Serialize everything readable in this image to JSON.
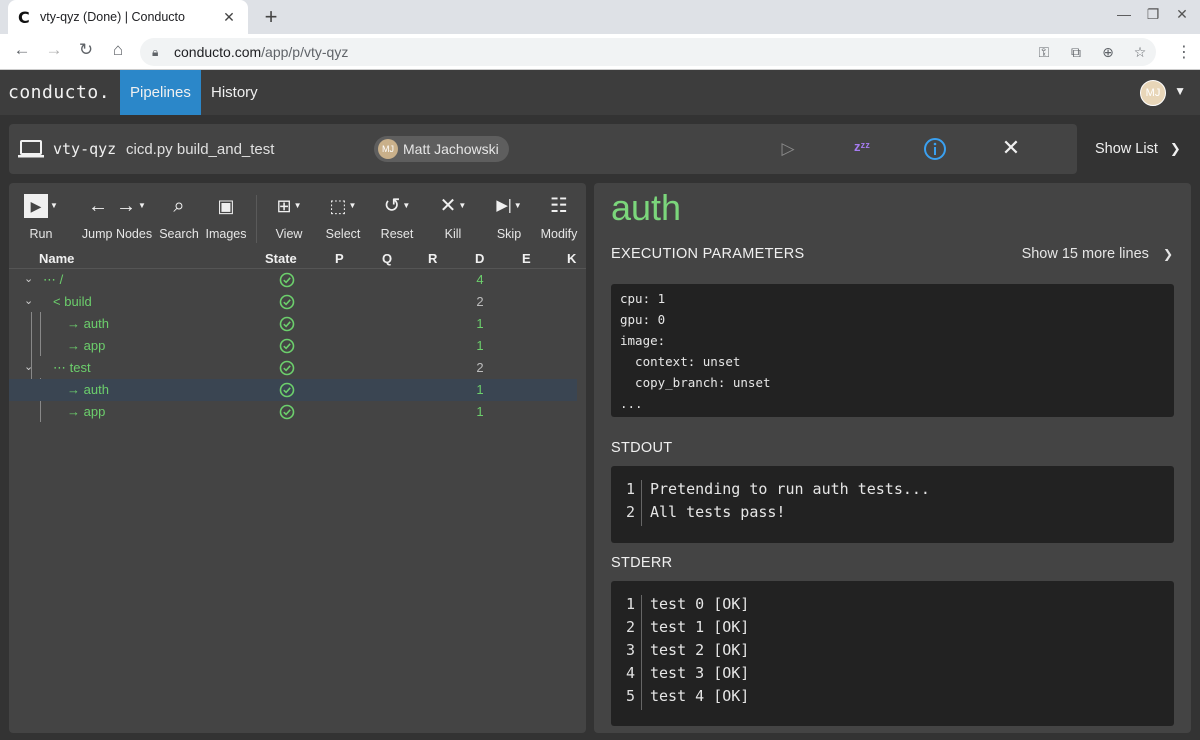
{
  "browser": {
    "tab_favicon": "C",
    "tab_title": "vty-qyz (Done) | Conducto",
    "url_host": "conducto.com",
    "url_path": "/app/p/vty-qyz"
  },
  "app": {
    "logo": "conducto.",
    "nav": [
      "Pipelines",
      "History"
    ],
    "user_initials": "MJ"
  },
  "pipeline": {
    "id": "vty-qyz",
    "command": "cicd.py build_and_test",
    "owner": "Matt Jachowski",
    "owner_initials": "MJ",
    "show_list": "Show List"
  },
  "toolbar": [
    "Run",
    "Jump Nodes",
    "Search",
    "Images",
    "View",
    "Select",
    "Reset",
    "Kill",
    "Skip",
    "Modify"
  ],
  "tree": {
    "columns": [
      "Name",
      "State",
      "P",
      "Q",
      "R",
      "D",
      "E",
      "K"
    ],
    "rows": [
      {
        "name": "/",
        "d": "4"
      },
      {
        "name": "build",
        "d": "2"
      },
      {
        "name": "auth",
        "d": "1"
      },
      {
        "name": "app",
        "d": "1"
      },
      {
        "name": "test",
        "d": "2"
      },
      {
        "name": "auth",
        "d": "1"
      },
      {
        "name": "app",
        "d": "1"
      }
    ]
  },
  "detail": {
    "title": "auth",
    "exec_params_title": "EXECUTION PARAMETERS",
    "show_more": "Show 15 more lines",
    "params": [
      "cpu: 1",
      "gpu: 0",
      "image:",
      "  context: unset",
      "  copy_branch: unset",
      "..."
    ],
    "stdout_title": "STDOUT",
    "stdout": [
      {
        "n": "1",
        "text": "Pretending to run auth tests..."
      },
      {
        "n": "2",
        "text": "All tests pass!"
      }
    ],
    "stderr_title": "STDERR",
    "stderr": [
      {
        "n": "1",
        "text": "test 0 [OK]"
      },
      {
        "n": "2",
        "text": "test 1 [OK]"
      },
      {
        "n": "3",
        "text": "test 2 [OK]"
      },
      {
        "n": "4",
        "text": "test 3 [OK]"
      },
      {
        "n": "5",
        "text": "test 4 [OK]"
      }
    ]
  },
  "colors": {
    "accent": "#2b87c9",
    "success": "#6ccf6c",
    "sleep": "#a67cf0",
    "info": "#3aa0f0"
  }
}
